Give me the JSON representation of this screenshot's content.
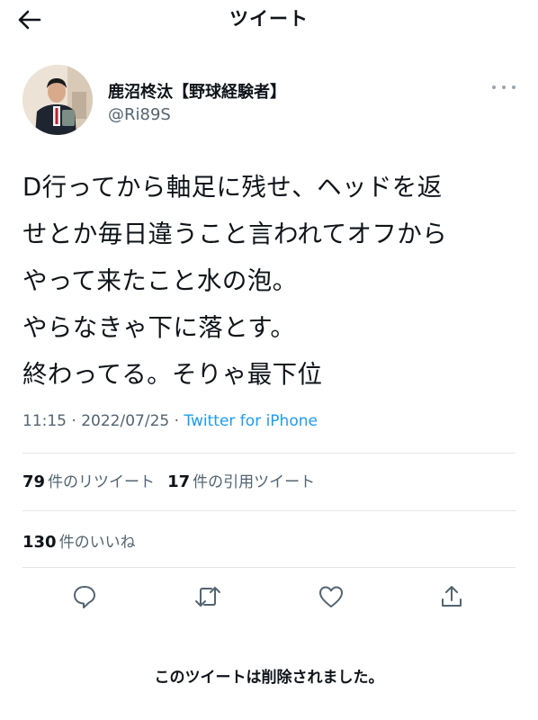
{
  "header": {
    "title": "ツイート",
    "back_icon": "arrow-left-icon"
  },
  "author": {
    "display_name": "鹿沼柊汰【野球経験者】",
    "handle": "@Ri89S",
    "more_icon": "more-horizontal-icon"
  },
  "tweet": {
    "lines": [
      "D行ってから軸足に残せ、ヘッドを返",
      "せとか毎日違うこと言われてオフから",
      "やって来たこと水の泡。",
      "やらなきゃ下に落とす。",
      "終わってる。そりゃ最下位"
    ],
    "time": "11:15",
    "separator": "·",
    "date": "2022/07/25",
    "source": "Twitter for iPhone"
  },
  "stats": {
    "retweets_count": "79",
    "retweets_label": "件のリツイート",
    "quotes_count": "17",
    "quotes_label": "件の引用ツイート",
    "likes_count": "130",
    "likes_label": "件のいいね"
  },
  "actions": [
    "reply-icon",
    "retweet-icon",
    "like-icon",
    "share-icon"
  ],
  "footer": {
    "deleted_message": "このツイートは削除されました。"
  },
  "colors": {
    "link": "#1d9bf0",
    "secondary_text": "#536471",
    "text": "#0f1419",
    "divider": "#e3e6e8"
  }
}
